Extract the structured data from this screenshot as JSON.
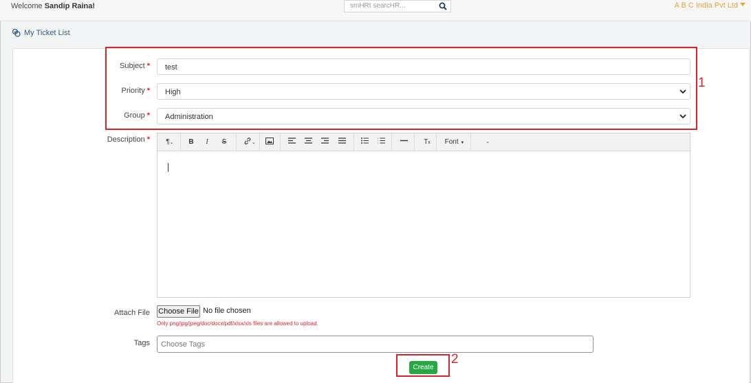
{
  "header": {
    "welcome_prefix": "Welcome",
    "user_name": "Sandip Raina!",
    "search_placeholder": "smHRt searcHR...",
    "company": "A B C India Pvt Ltd"
  },
  "nav": {
    "my_ticket_list": "My Ticket List"
  },
  "form": {
    "subject_label": "Subject",
    "subject_value": "test",
    "priority_label": "Priority",
    "priority_value": "High",
    "group_label": "Group",
    "group_value": "Administration",
    "description_label": "Description",
    "required_mark": "*",
    "attach_label": "Attach File",
    "choose_file": "Choose File",
    "no_file": "No file chosen",
    "file_hint": "Only png/jpg/jpeg/doc/docx/pdf/xlsx/xls files are allowed to upload.",
    "tags_label": "Tags",
    "tags_placeholder": "Choose Tags",
    "create_button": "Create"
  },
  "toolbar": {
    "bold": "B",
    "italic": "I",
    "strike": "S",
    "font": "Font"
  },
  "icons": [
    "ticket-icon",
    "search-icon",
    "caret-down-icon",
    "paragraph-icon",
    "link-icon",
    "image-icon",
    "align-left-icon",
    "align-center-icon",
    "align-right-icon",
    "justify-icon",
    "bulleted-list-icon",
    "numbered-list-icon",
    "horizontal-rule-icon",
    "clear-format-icon",
    "chevron-down-icon"
  ],
  "annotations": {
    "callout_1": "1",
    "callout_2": "2"
  },
  "colors": {
    "accent_orange": "#e6a23c",
    "link_blue": "#35597b",
    "required_red": "#d9232d",
    "create_green": "#28a745"
  }
}
